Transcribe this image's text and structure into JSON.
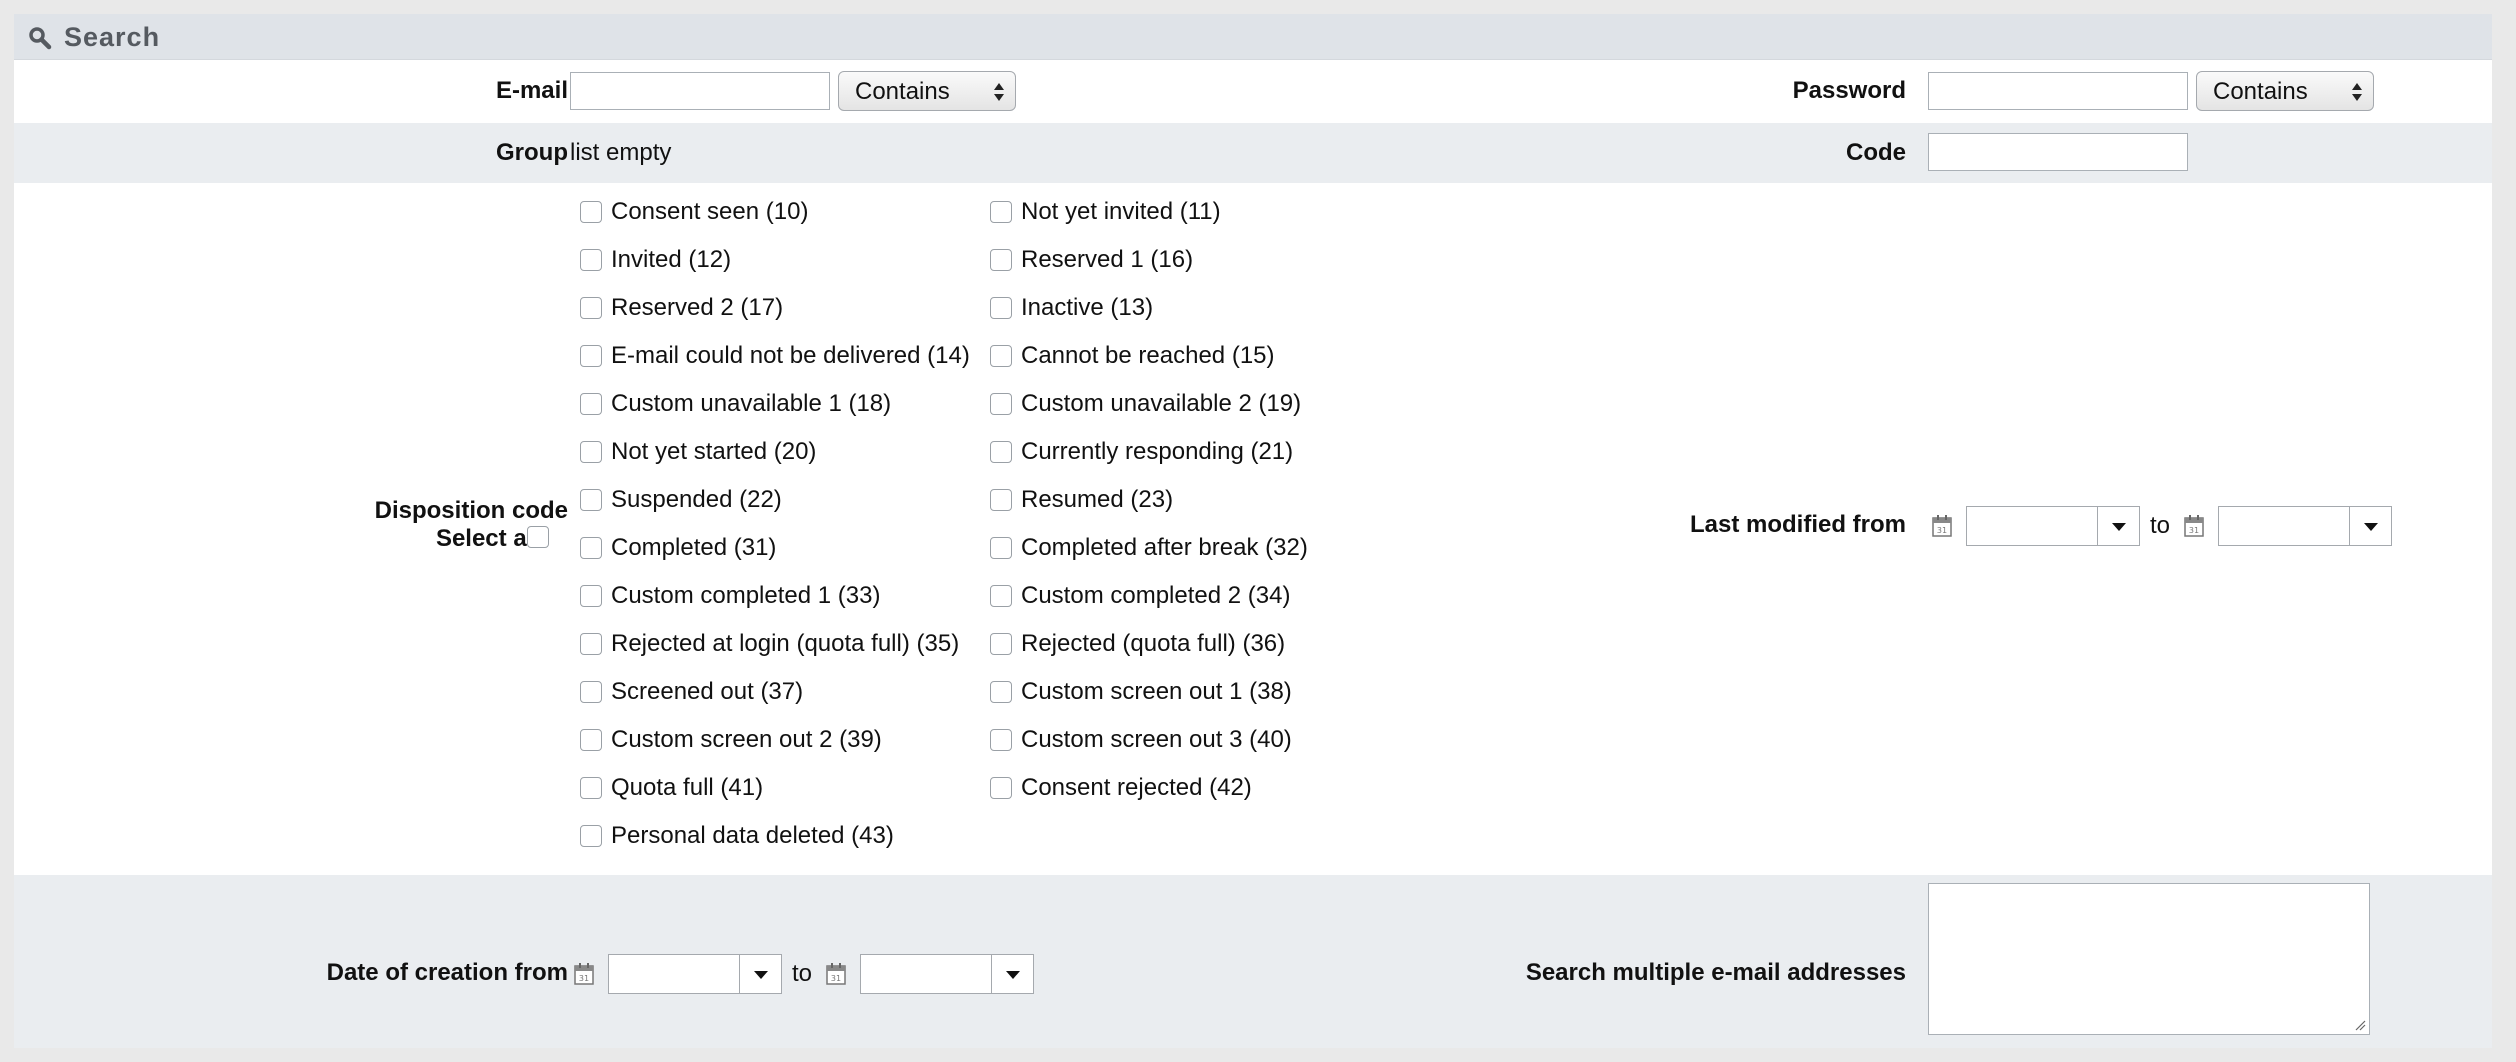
{
  "header": {
    "title": "Search"
  },
  "email": {
    "label": "E-mail",
    "value": "",
    "operator": "Contains"
  },
  "password": {
    "label": "Password",
    "value": "",
    "operator": "Contains"
  },
  "group": {
    "label": "Group",
    "value": "list empty"
  },
  "code": {
    "label": "Code",
    "value": ""
  },
  "disposition": {
    "label": "Disposition code",
    "select_all": "Select all",
    "col1": [
      "Consent seen (10)",
      "Invited (12)",
      "Reserved 2 (17)",
      "E-mail could not be delivered (14)",
      "Custom unavailable 1 (18)",
      "Not yet started (20)",
      "Suspended (22)",
      "Completed (31)",
      "Custom completed 1 (33)",
      "Rejected at login (quota full) (35)",
      "Screened out (37)",
      "Custom screen out 2 (39)",
      "Quota full (41)",
      "Personal data deleted (43)"
    ],
    "col2": [
      "Not yet invited (11)",
      "Reserved 1 (16)",
      "Inactive (13)",
      "Cannot be reached (15)",
      "Custom unavailable 2 (19)",
      "Currently responding (21)",
      "Resumed (23)",
      "Completed after break (32)",
      "Custom completed 2 (34)",
      "Rejected (quota full) (36)",
      "Custom screen out 1 (38)",
      "Custom screen out 3 (40)",
      "Consent rejected (42)"
    ]
  },
  "last_modified": {
    "label": "Last modified from",
    "to": "to"
  },
  "creation_date": {
    "label": "Date of creation from",
    "to": "to"
  },
  "multi_email": {
    "label": "Search multiple e-mail addresses",
    "value": ""
  },
  "icons": {
    "header": "search-icon",
    "date": "calendar-icon",
    "dropdown": "chevron-down-icon"
  },
  "colors": {
    "header_bg": "#dfe3e8",
    "alt_row_bg": "#eaedf0",
    "title_text": "#555a60"
  }
}
